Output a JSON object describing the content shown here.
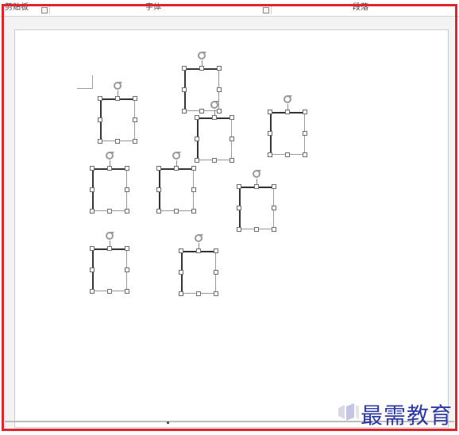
{
  "ribbon": {
    "groups": [
      {
        "label": "剪贴板"
      },
      {
        "label": "字体"
      },
      {
        "label": "段落"
      }
    ]
  },
  "canvas": {
    "shapes": [
      {
        "name": "rectangle-shape-1"
      },
      {
        "name": "rectangle-shape-2"
      },
      {
        "name": "rectangle-shape-3"
      },
      {
        "name": "rectangle-shape-4"
      },
      {
        "name": "rectangle-shape-5"
      },
      {
        "name": "rectangle-shape-6"
      },
      {
        "name": "rectangle-shape-7"
      },
      {
        "name": "rectangle-shape-8"
      },
      {
        "name": "rectangle-shape-9"
      }
    ]
  },
  "watermark": {
    "text": "最需教育"
  },
  "colors": {
    "frame": "#e0262c",
    "watermark": "#2e3aa8"
  }
}
